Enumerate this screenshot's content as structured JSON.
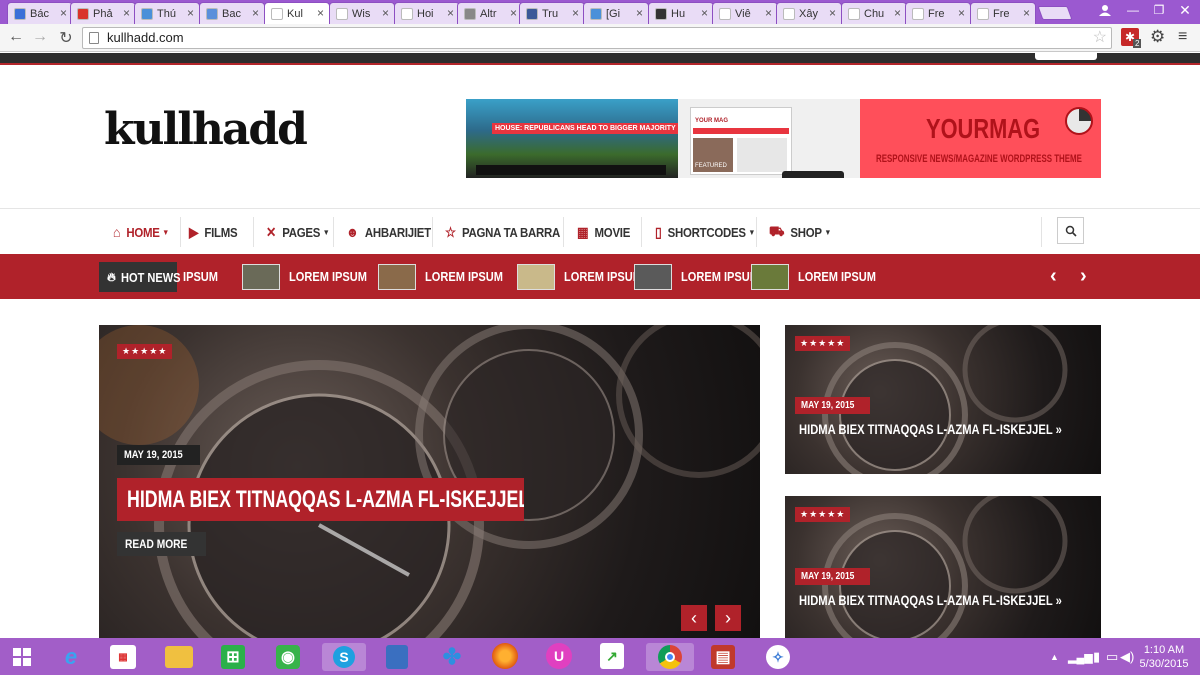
{
  "browser": {
    "tabs": [
      {
        "label": "Bác",
        "color": "#3b6fd8"
      },
      {
        "label": "Phả",
        "color": "#d9342b"
      },
      {
        "label": "Thú",
        "color": "#4a90d9"
      },
      {
        "label": "Bac",
        "color": "#5a8fdb"
      },
      {
        "label": "Kul",
        "color": "#ffffff"
      },
      {
        "label": "Wis",
        "color": "#ffffff"
      },
      {
        "label": "Hoi",
        "color": "#ffffff"
      },
      {
        "label": "Altr",
        "color": "#888888"
      },
      {
        "label": "Tru",
        "color": "#3b5998"
      },
      {
        "label": "[Gi",
        "color": "#4a90d9"
      },
      {
        "label": "Hu",
        "color": "#333333"
      },
      {
        "label": "Viê",
        "color": "#ffffff"
      },
      {
        "label": "Xây",
        "color": "#ffffff"
      },
      {
        "label": "Chu",
        "color": "#ffffff"
      },
      {
        "label": "Fre",
        "color": "#ffffff"
      },
      {
        "label": "Fre",
        "color": "#ffffff"
      }
    ],
    "active_tab": 4,
    "address": "kullhadd.com",
    "extension_badge": "2"
  },
  "site": {
    "logo": "kullhadd",
    "banner": {
      "headline": "HOUSE: REPUBLICANS HEAD TO BIGGER MAJORITY",
      "mock_label": "YOUR MAG",
      "featured_label": "FEATURED",
      "brand": "YOURMAG",
      "tagline": "RESPONSIVE NEWS/MAGAZINE WORDPRESS THEME"
    },
    "nav": [
      {
        "label": "HOME",
        "icon": "home-icon",
        "dropdown": true,
        "active": true
      },
      {
        "label": "FILMS",
        "icon": "video-icon",
        "dropdown": false
      },
      {
        "label": "PAGES",
        "icon": "cross-icon",
        "dropdown": true
      },
      {
        "label": "AHBARIJIET",
        "icon": "person-icon",
        "dropdown": false
      },
      {
        "label": "PAGNA TA BARRA",
        "icon": "star-icon",
        "dropdown": false
      },
      {
        "label": "MOVIE",
        "icon": "film-icon",
        "dropdown": false
      },
      {
        "label": "SHORTCODES",
        "icon": "page-icon",
        "dropdown": true
      },
      {
        "label": "SHOP",
        "icon": "cart-icon",
        "dropdown": true
      }
    ],
    "hot_news_label": "HOT NEWS",
    "hot_news": [
      {
        "label": "IPSUM",
        "thumb": ""
      },
      {
        "label": "LOREM IPSUM",
        "thumb": "#6a6a58"
      },
      {
        "label": "LOREM IPSUM",
        "thumb": "#8a6a4a"
      },
      {
        "label": "LOREM IPSUM",
        "thumb": "#c9b98a"
      },
      {
        "label": "LOREM IPSUM",
        "thumb": "#5a5a5a"
      },
      {
        "label": "LOREM IPSUM",
        "thumb": "#6a7a3a"
      }
    ],
    "main_slide": {
      "stars": "★★★★★",
      "date": "MAY 19, 2015",
      "title": "HIDMA BIEX TITNAQQAS L-AZMA FL-ISKEJJEL »",
      "read_more": "READ MORE"
    },
    "side_slides": [
      {
        "stars": "★★★★★",
        "date": "MAY 19, 2015",
        "title": "HIDMA BIEX TITNAQQAS L-AZMA FL-ISKEJJEL »"
      },
      {
        "stars": "★★★★★",
        "date": "MAY 19, 2015",
        "title": "HIDMA BIEX TITNAQQAS L-AZMA FL-ISKEJJEL »"
      }
    ]
  },
  "taskbar": {
    "time": "1:10 AM",
    "date": "5/30/2015"
  }
}
